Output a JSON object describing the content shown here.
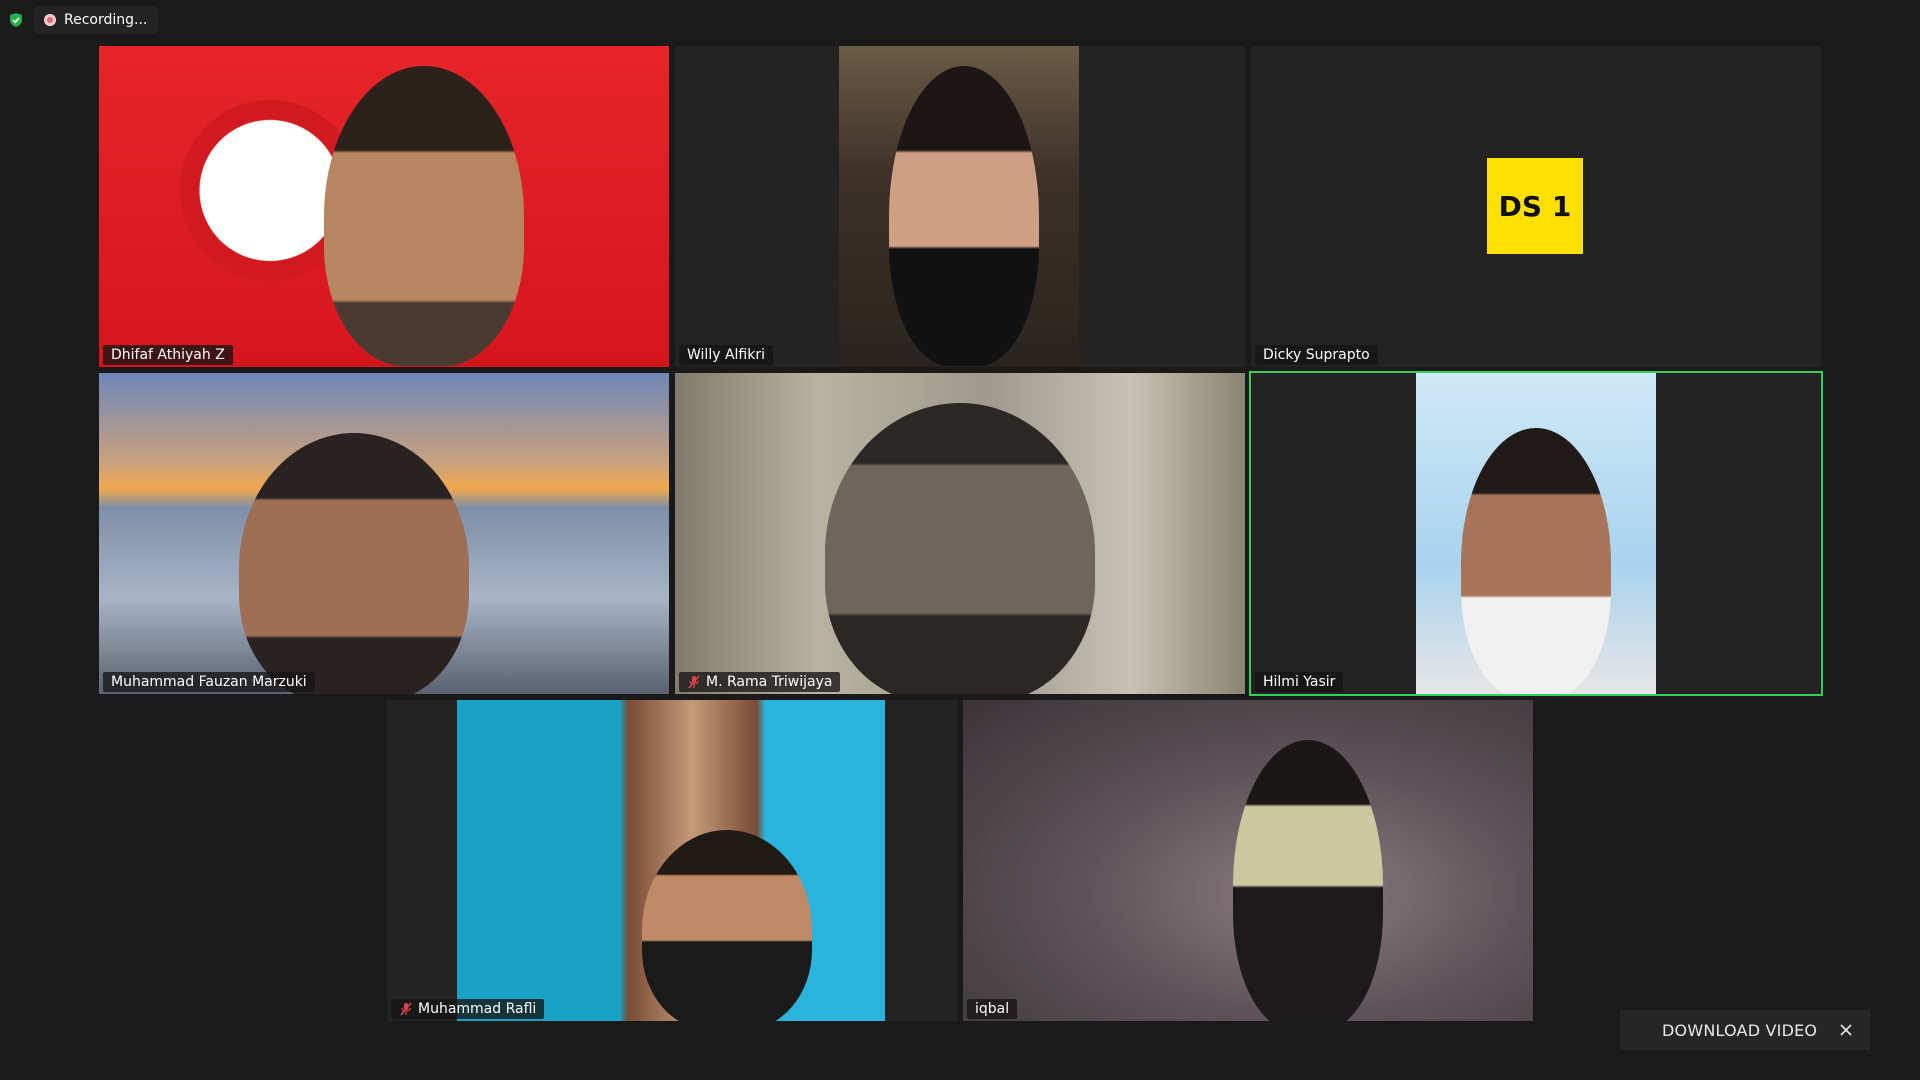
{
  "status": {
    "recording_label": "Recording...",
    "shield_icon": "shield-check-icon",
    "recording_icon": "record-dot-icon"
  },
  "participants": [
    {
      "name": "Dhifaf Athiyah Z",
      "muted": false,
      "video": true
    },
    {
      "name": "Willy Alfikri",
      "muted": false,
      "video": true
    },
    {
      "name": "Dicky Suprapto",
      "muted": false,
      "video": false,
      "avatar_text": "DS 1"
    },
    {
      "name": "Muhammad Fauzan Marzuki",
      "muted": false,
      "video": true
    },
    {
      "name": "M. Rama Triwijaya",
      "muted": true,
      "video": true
    },
    {
      "name": "Hilmi Yasir",
      "muted": false,
      "video": true,
      "active_speaker": true
    },
    {
      "name": "Muhammad Rafli",
      "muted": true,
      "video": true
    },
    {
      "name": "iqbal",
      "muted": false,
      "video": true
    }
  ],
  "download": {
    "label": "DOWNLOAD VIDEO",
    "close_icon": "close-icon"
  },
  "colors": {
    "background": "#1a1a1a",
    "active_speaker_border": "#30d158",
    "avatar_bg": "#ffe000",
    "mute_icon": "#e0424b"
  }
}
